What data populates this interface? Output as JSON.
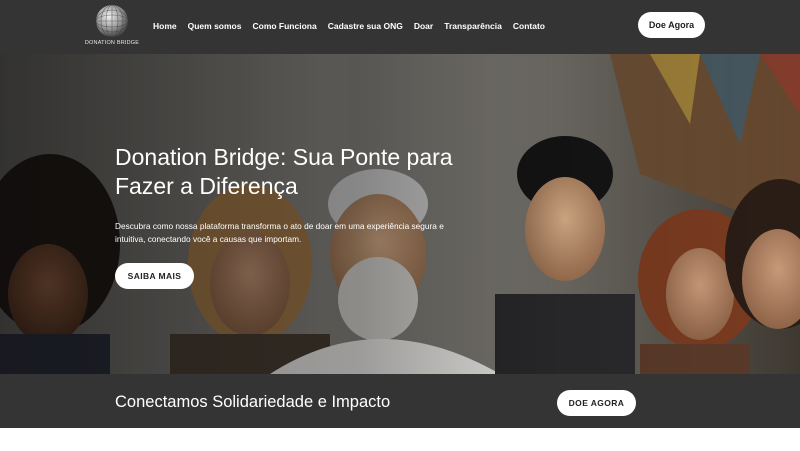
{
  "header": {
    "logo_text": "DONATION BRIDGE",
    "nav": [
      {
        "label": "Home",
        "id": "home"
      },
      {
        "label": "Quem somos",
        "id": "quem-somos"
      },
      {
        "label": "Como Funciona",
        "id": "como-funciona"
      },
      {
        "label": "Cadastre sua ONG",
        "id": "cadastre-ong"
      },
      {
        "label": "Doar",
        "id": "doar"
      },
      {
        "label": "Transparência",
        "id": "transparencia"
      },
      {
        "label": "Contato",
        "id": "contato"
      }
    ],
    "cta_label": "Doe Agora"
  },
  "hero": {
    "title": "Donation Bridge: Sua Ponte para Fazer a Diferença",
    "description": "Descubra como nossa plataforma transforma o ato de doar em uma experiência segura e intuitiva, conectando você a causas que importam.",
    "button_label": "SAIBA MAIS"
  },
  "banner": {
    "text": "Conectamos Solidariedade e Impacto",
    "button_label": "DOE AGORA"
  },
  "colors": {
    "header_bg": "#353435",
    "button_bg": "#ffffff"
  }
}
